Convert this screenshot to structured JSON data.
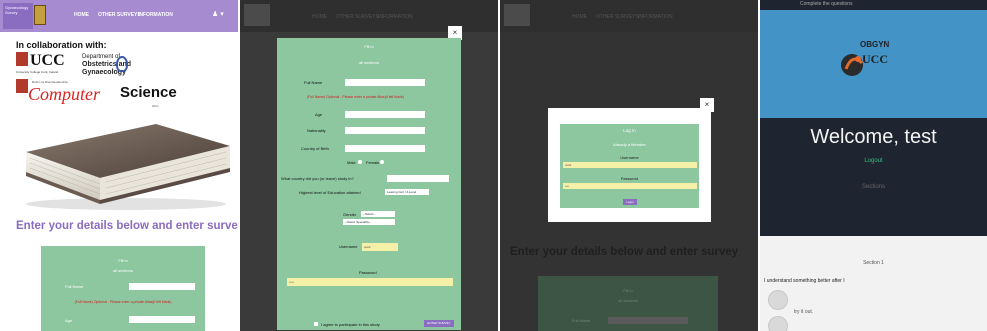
{
  "panel1": {
    "nav": {
      "logo_text": "Gynaecology Survey",
      "items": [
        "HOME",
        "OTHER SURVEYS",
        "INFORMATION"
      ],
      "user_glyph": "♟ ▾"
    },
    "collab_title": "In collaboration with:",
    "ucc_text": "UCC",
    "ucc_sub": "University College Cork, Ireland",
    "obs_lines": [
      "Department of",
      "Obstetrics and",
      "Gynaecology"
    ],
    "cs_small": "Roinn na Ríomheolaíochta",
    "cs_computer": "Computer",
    "cs_science": "Science",
    "cs_tag": "UCC",
    "enter_title": "Enter your details below and enter survey",
    "form": {
      "fill_in": "Fill in",
      "all_sections": "all sections",
      "full_name_label": "Full Name",
      "error": "(Full Name) Optional - Please enter a private Alias(if left blank)",
      "age_label": "Age"
    }
  },
  "panel2": {
    "nav_items": [
      "HOME",
      "OTHER SURVEYS",
      "INFORMATION"
    ],
    "close": "×",
    "fill_in": "Fill in",
    "all_sections": "all sections",
    "full_name_label": "Full Name",
    "error": "(Full Name) Optional - Please enter a private Alias(if left blank)",
    "age_label": "Age",
    "nationality_label": "Nationality",
    "country_label": "Country of Birth",
    "male_label": "Male",
    "female_label": "Female",
    "study_country_label": "What country did you (or leave) study in?",
    "education_label": "Highest level of Education attained",
    "education_value": "Leaving Cert / A Level",
    "gender_label": "Gender",
    "gender_value": "--Select--",
    "speciality_value": "--Select Speciality--",
    "username_label": "Username",
    "username_value": "test2",
    "password_label": "Password",
    "password_value": "•••••",
    "agree_label": "I agree to participate in this study",
    "enter_button": "ENTER SURVEY"
  },
  "panel3": {
    "nav_items": [
      "HOME",
      "OTHER SURVEYS",
      "INFORMATION"
    ],
    "close": "×",
    "login_title": "Log In",
    "already_member": "Already a Member",
    "username_label": "Username",
    "username_value": "test1",
    "password_label": "Password",
    "password_value": "••••",
    "login_button": "Login",
    "enter_title": "Enter your details below and enter survey",
    "fill_in": "Fill in",
    "all_sections": "all sections",
    "full_name_label": "Full Name"
  },
  "panel4": {
    "top_text": "Complete the questions",
    "logo_text": "UCC",
    "logo_prefix": "OBGYN",
    "welcome": "Welcome, test",
    "logout": "Logout",
    "sections": "Sections",
    "section_title": "Section 1",
    "question": "I understand something better after I",
    "option_label": "try it out."
  },
  "colors": {
    "purple": "#a78bd0",
    "green_form": "#8cc7a0",
    "yellow_input": "#f4f0a8",
    "error_red": "#d02020",
    "blue_header": "#4393c7",
    "dark_bg": "#1e2430",
    "logout_green": "#2ec27e"
  }
}
